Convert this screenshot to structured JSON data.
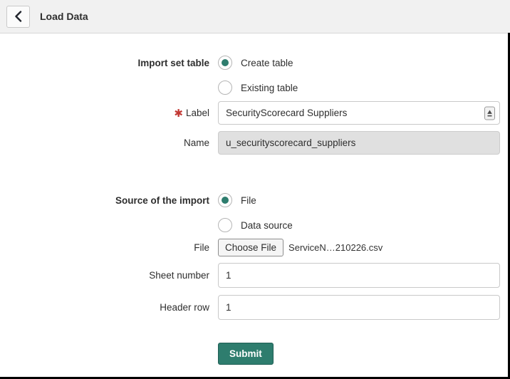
{
  "header": {
    "title": "Load Data"
  },
  "form": {
    "import_set_table": {
      "label": "Import set table",
      "options": [
        {
          "label": "Create table",
          "selected": true
        },
        {
          "label": "Existing table",
          "selected": false
        }
      ]
    },
    "label_field": {
      "label": "Label",
      "required_marker": "✱",
      "value": "SecurityScorecard Suppliers"
    },
    "name_field": {
      "label": "Name",
      "value": "u_securityscorecard_suppliers",
      "readonly": true
    },
    "source": {
      "label": "Source of the import",
      "options": [
        {
          "label": "File",
          "selected": true
        },
        {
          "label": "Data source",
          "selected": false
        }
      ]
    },
    "file_field": {
      "label": "File",
      "button_label": "Choose File",
      "filename": "ServiceN…210226.csv"
    },
    "sheet_number": {
      "label": "Sheet number",
      "value": "1"
    },
    "header_row": {
      "label": "Header row",
      "value": "1"
    },
    "submit_label": "Submit"
  },
  "icons": {
    "back": "chevron-left",
    "label_input": "autofill"
  },
  "colors": {
    "accent_teal": "#2e7d6e",
    "submit_border": "#1f5e54",
    "required_red": "#c23934",
    "header_bg": "#f1f1f1",
    "readonly_bg": "#e0e0e0"
  }
}
